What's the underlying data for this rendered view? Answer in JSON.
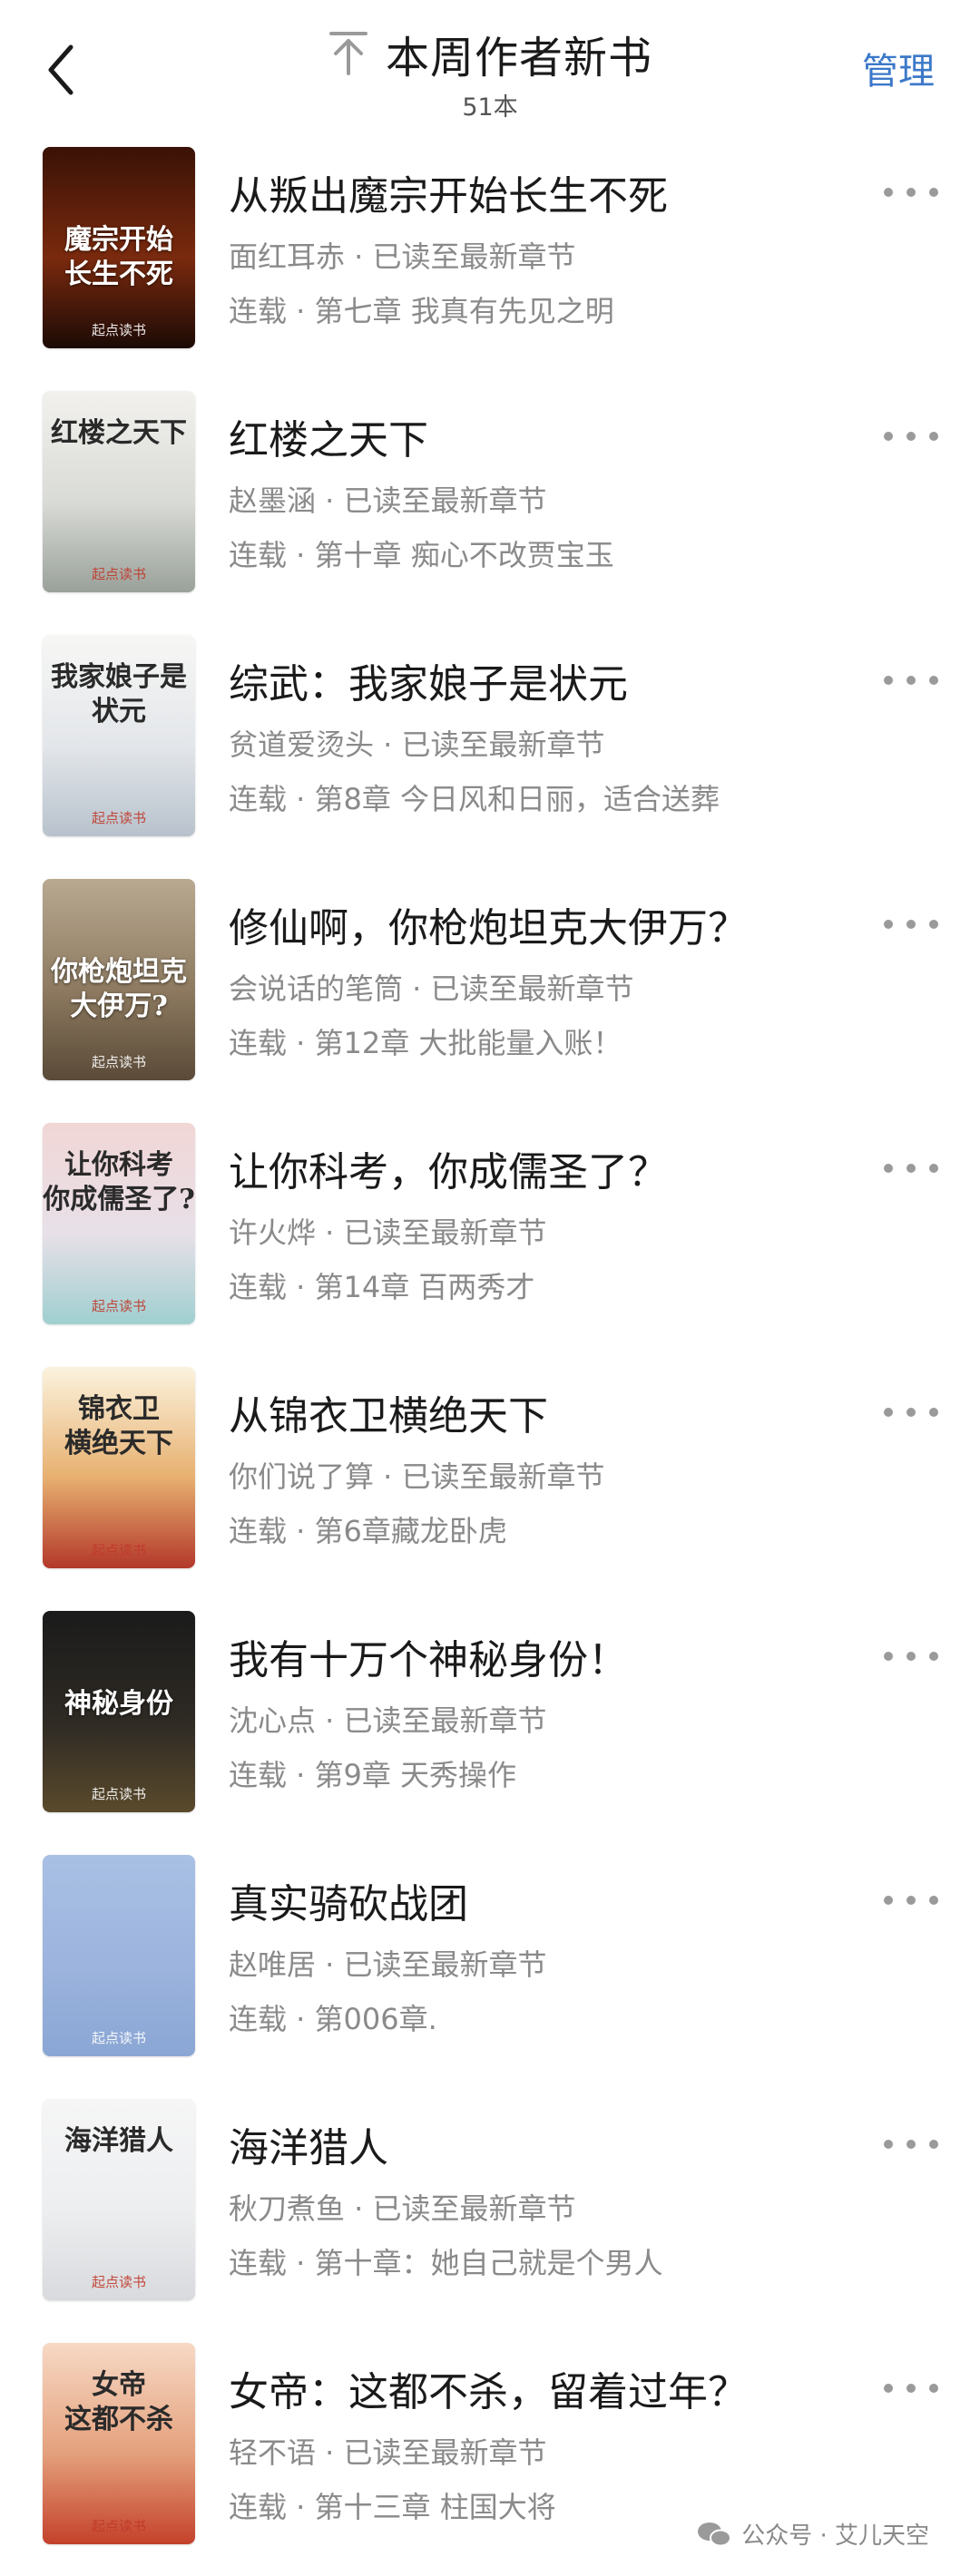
{
  "header": {
    "title": "本周作者新书",
    "count": "51本",
    "manage_label": "管理"
  },
  "books": [
    {
      "title": "从叛出魔宗开始长生不死",
      "meta": "面红耳赤 · 已读至最新章节",
      "chapter": "连载 · 第七章 我真有先见之明",
      "cover_text": "魔宗开始\n长生不死",
      "cover_colors": [
        "#3a1206",
        "#7a2a0e",
        "#1c0a05"
      ]
    },
    {
      "title": "红楼之天下",
      "meta": "赵墨涵 · 已读至最新章节",
      "chapter": "连载 · 第十章 痴心不改贾宝玉",
      "cover_text": "红楼之天下",
      "cover_colors": [
        "#f2f1ee",
        "#d9dbd7",
        "#9aa19a"
      ]
    },
    {
      "title": "综武：我家娘子是状元",
      "meta": "贫道爱烫头 · 已读至最新章节",
      "chapter": "连载 · 第8章 今日风和日丽，适合送葬",
      "cover_text": "我家娘子是状元",
      "cover_colors": [
        "#f7f7f5",
        "#e3e6ea",
        "#b8c2cc"
      ]
    },
    {
      "title": "修仙啊，你枪炮坦克大伊万？",
      "meta": "会说话的笔筒 · 已读至最新章节",
      "chapter": "连载 · 第12章 大批能量入账！",
      "cover_text": "你枪炮坦克大伊万?",
      "cover_colors": [
        "#b8a990",
        "#8d7a60",
        "#5a4a38"
      ]
    },
    {
      "title": "让你科考，你成儒圣了？",
      "meta": "许火烨 · 已读至最新章节",
      "chapter": "连载 · 第14章 百两秀才",
      "cover_text": "让你科考\n你成儒圣了?",
      "cover_colors": [
        "#f1d6d6",
        "#e8e0e8",
        "#9fcfd0"
      ]
    },
    {
      "title": "从锦衣卫横绝天下",
      "meta": "你们说了算 · 已读至最新章节",
      "chapter": "连载 · 第6章藏龙卧虎",
      "cover_text": "锦衣卫\n横绝天下",
      "cover_colors": [
        "#fbf3de",
        "#e7b070",
        "#b3382a"
      ]
    },
    {
      "title": "我有十万个神秘身份！",
      "meta": "沈心点 · 已读至最新章节",
      "chapter": "连载 · 第9章 天秀操作",
      "cover_text": "神秘身份",
      "cover_colors": [
        "#1b1b1b",
        "#2e2a24",
        "#5a4a2c"
      ]
    },
    {
      "title": "真实骑砍战团",
      "meta": "赵唯居 · 已读至最新章节",
      "chapter": "连载 · 第006章.",
      "cover_text": "",
      "cover_colors": [
        "#a9c0e4",
        "#9cb4de",
        "#8aa6d4"
      ]
    },
    {
      "title": "海洋猎人",
      "meta": "秋刀煮鱼 · 已读至最新章节",
      "chapter": "连载 · 第十章：她自己就是个男人",
      "cover_text": "海洋猎人",
      "cover_colors": [
        "#f6f6f6",
        "#eceef0",
        "#d8dadd"
      ]
    },
    {
      "title": "女帝：这都不杀，留着过年？",
      "meta": "轻不语 · 已读至最新章节",
      "chapter": "连载 · 第十三章 柱国大将",
      "cover_text": "女帝\n这都不杀",
      "cover_colors": [
        "#f7d9c5",
        "#e4a07c",
        "#c4412a"
      ]
    }
  ],
  "cover_logo": "起点读书",
  "watermark": "公众号 · 艾儿天空",
  "colors": {
    "accent": "#3c78c9",
    "meta_gray": "#8a8a8a",
    "dots_gray": "#9a9a9a"
  }
}
